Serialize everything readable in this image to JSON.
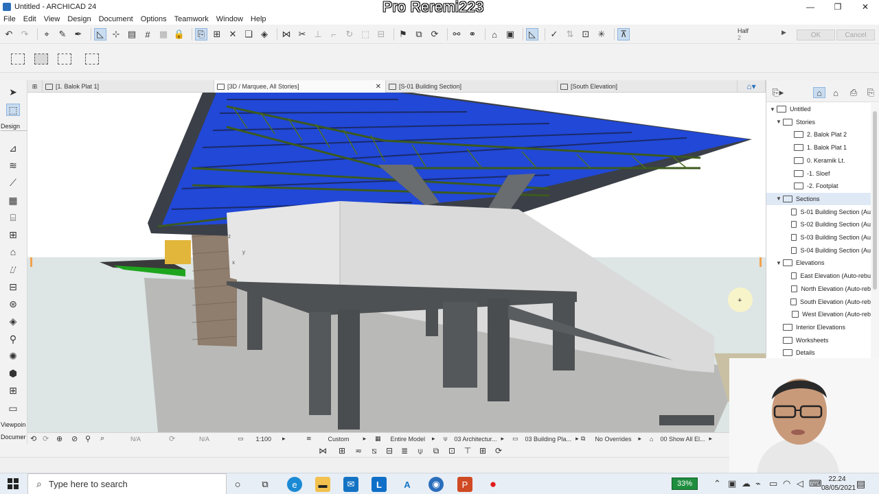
{
  "window": {
    "title": "Untitled - ARCHICAD 24",
    "watermark": "Pro Reremi223",
    "controls": {
      "minimize": "—",
      "restore": "❐",
      "close": "✕"
    }
  },
  "menu": [
    "File",
    "Edit",
    "View",
    "Design",
    "Document",
    "Options",
    "Teamwork",
    "Window",
    "Help"
  ],
  "toolbar": {
    "half_label": "Half",
    "half_value": "2",
    "ok_label": "OK",
    "cancel_label": "Cancel"
  },
  "toolbox": {
    "design_label": "Design",
    "viewpoint_label": "Viewpoin",
    "document_label": "Documer"
  },
  "tabs": [
    {
      "label": "[1. Balok Plat 1]"
    },
    {
      "label": "[3D / Marquee, All Stories]",
      "close": "✕"
    },
    {
      "label": "[S-01 Building Section]"
    },
    {
      "label": "[South Elevation]"
    }
  ],
  "viewport": {
    "axis_z": "z",
    "axis_y": "y",
    "axis_x": "x",
    "cursor": "+"
  },
  "statusbar": {
    "na1": "N/A",
    "na2": "N/A",
    "scale": "1:100",
    "layer_combo": "Custom",
    "model_view": "Entire Model",
    "pen_set": "03 Architectur...",
    "mvo": "03 Building Pla...",
    "overrides": "No Overrides",
    "renovation": "00 Show All El..."
  },
  "navigator": {
    "items": [
      {
        "label": "Untitled",
        "level": 0,
        "twisty": "▼"
      },
      {
        "label": "Stories",
        "level": 1,
        "twisty": "▼"
      },
      {
        "label": "2. Balok Plat 2",
        "level": 2
      },
      {
        "label": "1. Balok Plat 1",
        "level": 2
      },
      {
        "label": "0. Keramik Lt.",
        "level": 2
      },
      {
        "label": "-1. Sloef",
        "level": 2
      },
      {
        "label": "-2. Footplat",
        "level": 2
      },
      {
        "label": "Sections",
        "level": 1,
        "twisty": "▼",
        "selected": true
      },
      {
        "label": "S-01 Building Section (Au",
        "level": 2
      },
      {
        "label": "S-02 Building Section (Au",
        "level": 2
      },
      {
        "label": "S-03 Building Section (Au",
        "level": 2
      },
      {
        "label": "S-04 Building Section (Au",
        "level": 2
      },
      {
        "label": "Elevations",
        "level": 1,
        "twisty": "▼"
      },
      {
        "label": "East Elevation (Auto-rebu",
        "level": 2
      },
      {
        "label": "North Elevation (Auto-reb",
        "level": 2
      },
      {
        "label": "South Elevation (Auto-reb",
        "level": 2
      },
      {
        "label": "West Elevation (Auto-reb",
        "level": 2
      },
      {
        "label": "Interior Elevations",
        "level": 1
      },
      {
        "label": "Worksheets",
        "level": 1
      },
      {
        "label": "Details",
        "level": 1
      }
    ]
  },
  "taskbar": {
    "search_placeholder": "Type here to search",
    "battery": "33%",
    "time": "22.24",
    "date": "08/05/2021"
  },
  "colors": {
    "roof_blue": "#2148d6",
    "truss_green": "#3c5a1e",
    "concrete": "#4e5153",
    "slab_white": "#e6e6e6",
    "floor": "#b9bab8",
    "battery_green": "#1e8e3e"
  }
}
